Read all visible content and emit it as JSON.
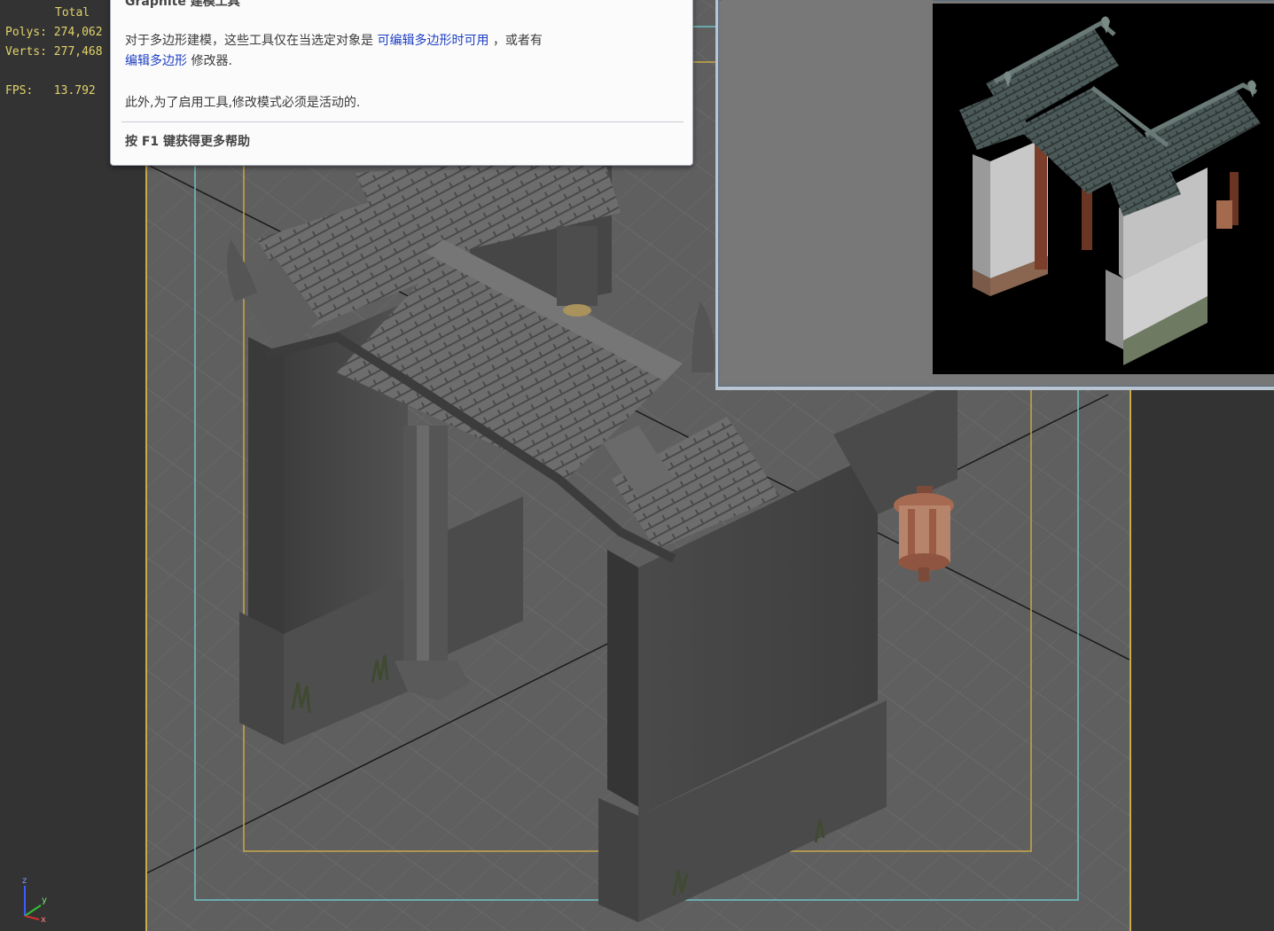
{
  "stats": {
    "total_label": "Total",
    "polys_label": "Polys:",
    "polys_value": "274,062",
    "verts_label": "Verts:",
    "verts_value": "277,468",
    "fps_label": "FPS:",
    "fps_value": "13.792"
  },
  "tooltip": {
    "title": "Graphite 建模工具",
    "line1_a": "对于多边形建模，这些工具仅在当选定对象是 ",
    "line1_link": "可编辑多边形时可用",
    "line1_b": " ，或者有",
    "line2_link": "编辑多边形",
    "line2_b": " 修改器.",
    "line3": "此外,为了启用工具,修改模式必须是活动的.",
    "help": "按 F1 键获得更多帮助"
  },
  "axis": {
    "z": "z",
    "y": "y",
    "x": "x"
  },
  "colors": {
    "stats_text": "#e3d36a",
    "link": "#1c3ec2",
    "safe_frame_yellow": "#c9a94a",
    "safe_frame_cyan": "#6fc3c6",
    "viewport_bg": "#5c5c5c"
  }
}
